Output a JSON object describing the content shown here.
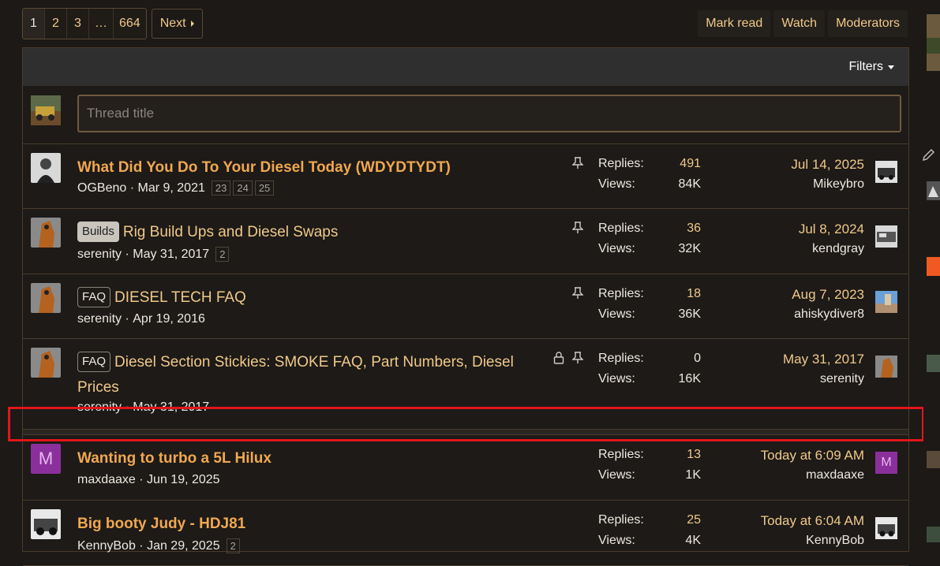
{
  "pagination": {
    "pages": [
      "1",
      "2",
      "3",
      "…",
      "664"
    ],
    "current": "1",
    "next_label": "Next"
  },
  "actions": {
    "mark_read": "Mark read",
    "watch": "Watch",
    "moderators": "Moderators"
  },
  "filters_label": "Filters",
  "new_thread": {
    "placeholder": "Thread title"
  },
  "threads": [
    {
      "title": "What Did You Do To Your Diesel Today (WDYDTYDT)",
      "prefix": "",
      "author": "OGBeno",
      "date": "Mar 9, 2021",
      "pages": [
        "23",
        "24",
        "25"
      ],
      "replies": "491",
      "views": "84K",
      "last_date": "Jul 14, 2025",
      "last_user": "Mikeybro",
      "sticky": true,
      "locked": false,
      "bold": true
    },
    {
      "title": "Rig Build Ups and Diesel Swaps",
      "prefix": "Builds",
      "author": "serenity",
      "date": "May 31, 2017",
      "pages": [
        "2"
      ],
      "replies": "36",
      "views": "32K",
      "last_date": "Jul 8, 2024",
      "last_user": "kendgray",
      "sticky": true,
      "locked": false,
      "bold": false
    },
    {
      "title": "DIESEL TECH FAQ",
      "prefix": "FAQ",
      "author": "serenity",
      "date": "Apr 19, 2016",
      "pages": [],
      "replies": "18",
      "views": "36K",
      "last_date": "Aug 7, 2023",
      "last_user": "ahiskydiver8",
      "sticky": true,
      "locked": false,
      "bold": false
    },
    {
      "title": "Diesel Section Stickies: SMOKE FAQ, Part Numbers, Diesel Prices",
      "prefix": "FAQ",
      "author": "serenity",
      "date": "May 31, 2017",
      "pages": [],
      "replies": "0",
      "views": "16K",
      "last_date": "May 31, 2017",
      "last_user": "serenity",
      "sticky": true,
      "locked": true,
      "bold": false
    },
    {
      "title": "Wanting to turbo a 5L Hilux",
      "prefix": "",
      "author": "maxdaaxe",
      "date": "Jun 19, 2025",
      "pages": [],
      "replies": "13",
      "views": "1K",
      "last_date": "Today at 6:09 AM",
      "last_user": "maxdaaxe",
      "sticky": false,
      "locked": false,
      "bold": true,
      "avatar_letter": "M"
    },
    {
      "title": "Big booty Judy - HDJ81",
      "prefix": "",
      "author": "KennyBob",
      "date": "Jan 29, 2025",
      "pages": [
        "2"
      ],
      "replies": "25",
      "views": "4K",
      "last_date": "Today at 6:04 AM",
      "last_user": "KennyBob",
      "sticky": false,
      "locked": false,
      "bold": true
    }
  ],
  "labels": {
    "replies": "Replies:",
    "views": "Views:"
  },
  "colors": {
    "accent": "#f0c98a",
    "unread_title": "#f0a850",
    "border": "#4a3c2b",
    "highlight_box": "#e0161b"
  }
}
